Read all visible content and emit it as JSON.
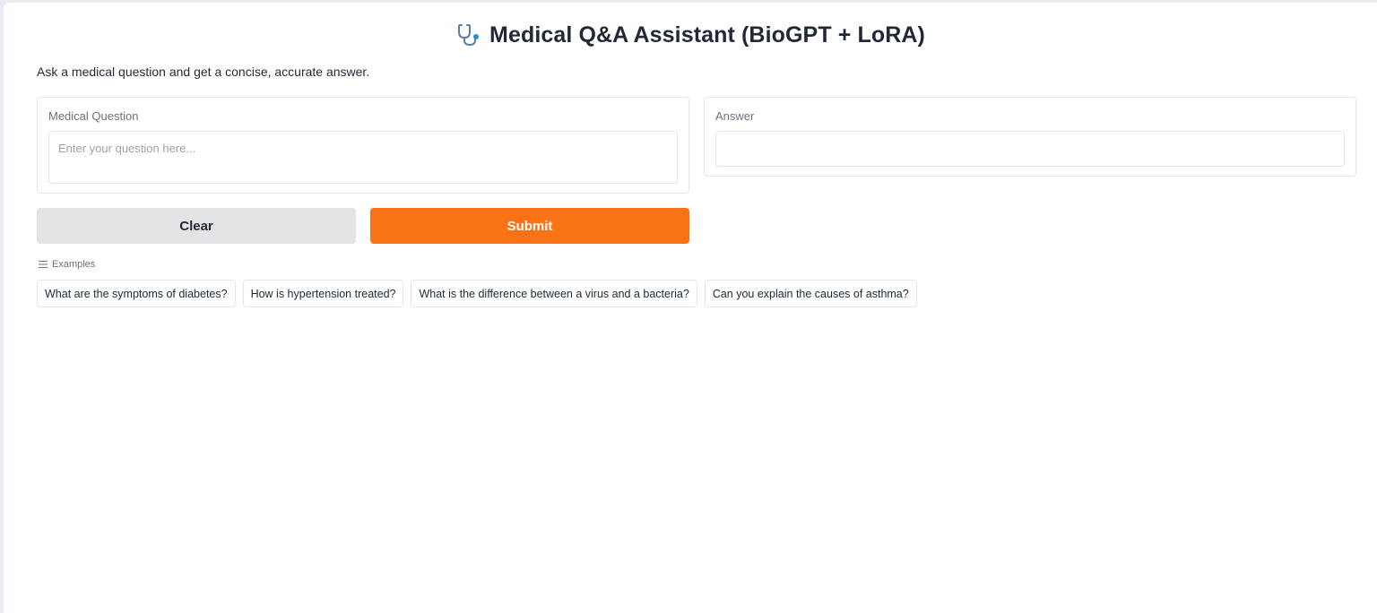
{
  "header": {
    "icon": "stethoscope-icon",
    "title": "Medical Q&A Assistant (BioGPT + LoRA)",
    "description": "Ask a medical question and get a concise, accurate answer."
  },
  "question": {
    "label": "Medical Question",
    "placeholder": "Enter your question here...",
    "value": ""
  },
  "answer": {
    "label": "Answer",
    "value": ""
  },
  "buttons": {
    "clear": "Clear",
    "submit": "Submit"
  },
  "examples": {
    "icon": "list-icon",
    "label": "Examples",
    "items": [
      "What are the symptoms of diabetes?",
      "How is hypertension treated?",
      "What is the difference between a virus and a bacteria?",
      "Can you explain the causes of asthma?"
    ]
  },
  "colors": {
    "accent": "#f97316",
    "secondary_button": "#e4e4e7",
    "border": "#e4e4e7",
    "stethoscope_tube": "#5b7fa3",
    "stethoscope_chest": "#2a8bd8"
  }
}
